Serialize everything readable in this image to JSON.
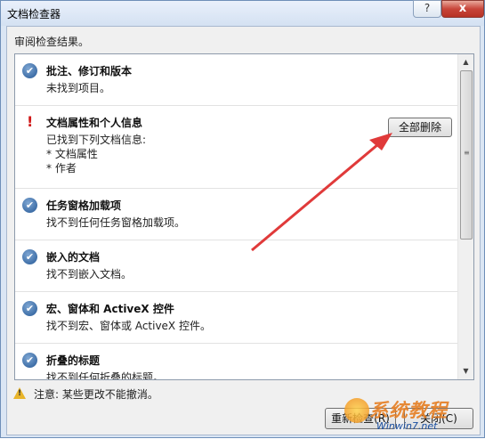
{
  "window": {
    "title": "文档检查器",
    "help_glyph": "?",
    "close_glyph": "x"
  },
  "header": {
    "review_label": "审阅检查结果。"
  },
  "items": [
    {
      "status": "ok",
      "title": "批注、修订和版本",
      "desc": [
        "未找到项目。"
      ]
    },
    {
      "status": "found",
      "title": "文档属性和个人信息",
      "desc": [
        "已找到下列文档信息:",
        "* 文档属性",
        "* 作者"
      ],
      "button": "全部删除"
    },
    {
      "status": "ok",
      "title": "任务窗格加载项",
      "desc": [
        "找不到任何任务窗格加载项。"
      ]
    },
    {
      "status": "ok",
      "title": "嵌入的文档",
      "desc": [
        "找不到嵌入文档。"
      ]
    },
    {
      "status": "ok",
      "title": "宏、窗体和 ActiveX 控件",
      "desc": [
        "找不到宏、窗体或 ActiveX 控件。"
      ]
    },
    {
      "status": "ok",
      "title": "折叠的标题",
      "desc": [
        "找不到任何折叠的标题。"
      ]
    }
  ],
  "icons": {
    "ok": "checkmark-circle-icon",
    "found": "exclamation-icon",
    "note": "warning-triangle-icon"
  },
  "note": {
    "text": "注意: 某些更改不能撤消。"
  },
  "buttons": {
    "recheck": "重新检查(R)",
    "close": "关闭(C)"
  },
  "watermark": {
    "text": "系统教程",
    "sub": "Winwin7.net"
  },
  "colors": {
    "accent": "#3f6fa8",
    "warning": "#d01818",
    "arrow": "#e03a3a"
  }
}
